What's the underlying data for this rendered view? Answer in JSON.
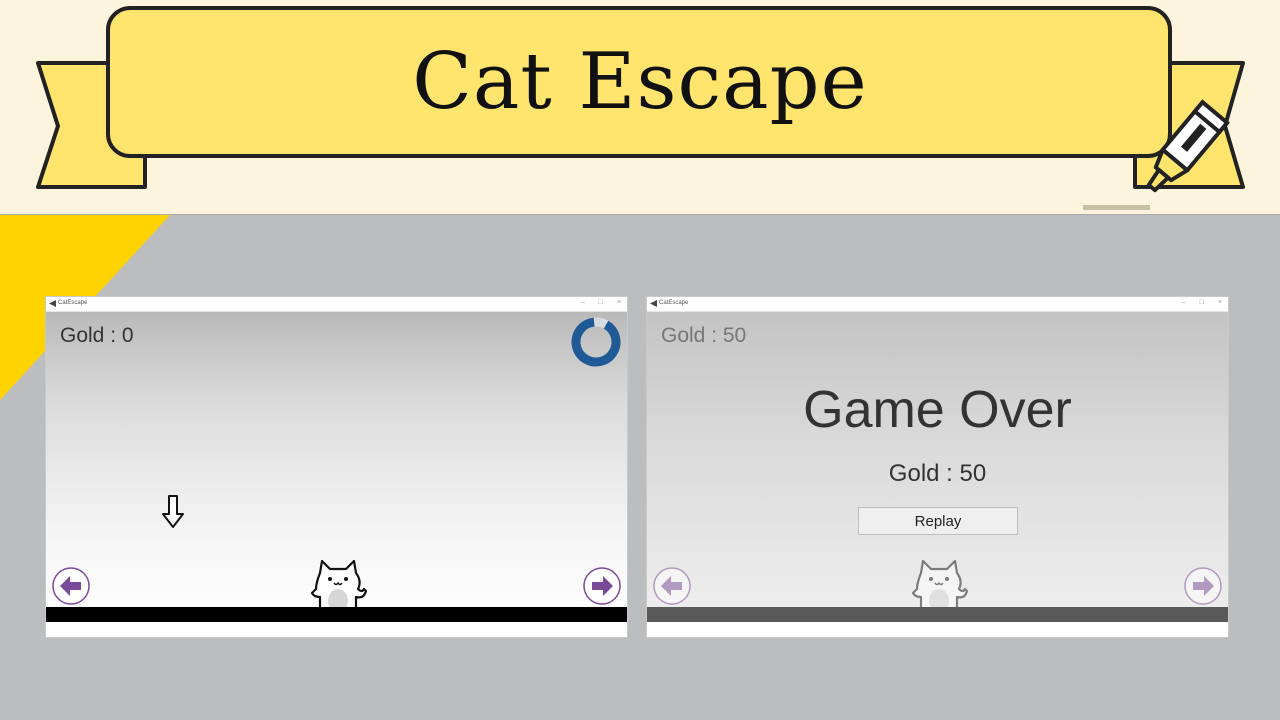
{
  "header": {
    "title": "Cat Escape"
  },
  "window_left": {
    "app_title": "CatEscape",
    "controls": {
      "minimize": "–",
      "maximize": "□",
      "close": "×"
    },
    "gold_label": "Gold : 0",
    "timer": {
      "fill": 0.9
    }
  },
  "window_right": {
    "app_title": "CatEscape",
    "controls": {
      "minimize": "–",
      "maximize": "□",
      "close": "×"
    },
    "gold_label": "Gold : 50",
    "game_over": "Game Over",
    "final_gold": "Gold : 50",
    "replay_label": "Replay"
  },
  "colors": {
    "ribbon": "#ffe56e",
    "header_bg": "#fdf4de",
    "slide_bg": "#bcbdbf",
    "corner_accent": "#ffd300",
    "timer_ring": "#1f5a96",
    "arrow_button": "#7a4a98"
  },
  "icons": {
    "left_button": "arrow-left-icon",
    "right_button": "arrow-right-icon",
    "falling_object": "down-arrow-icon",
    "player": "cat-icon",
    "decoration": "highlighter-pen-icon"
  }
}
